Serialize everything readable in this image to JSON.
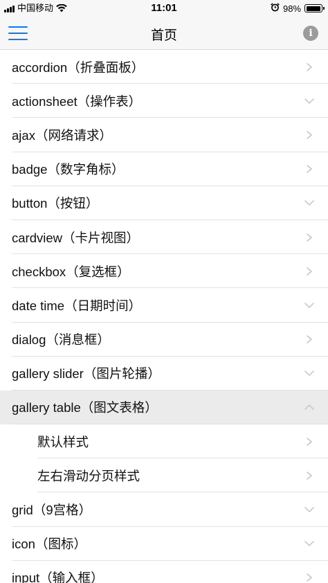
{
  "status_bar": {
    "carrier": "中国移动",
    "time": "11:01",
    "battery": "98%",
    "battery_level": 0.98
  },
  "nav": {
    "title": "首页",
    "menu_icon": "hamburger-menu-icon",
    "info_icon": "info-icon",
    "info_glyph": "i",
    "accent_color": "#007aff"
  },
  "list": {
    "items": [
      {
        "label": "accordion（折叠面板）",
        "icon": "chevron-right-icon"
      },
      {
        "label": "actionsheet（操作表）",
        "icon": "chevron-down-icon"
      },
      {
        "label": "ajax（网络请求）",
        "icon": "chevron-right-icon"
      },
      {
        "label": "badge（数字角标）",
        "icon": "chevron-right-icon"
      },
      {
        "label": "button（按钮）",
        "icon": "chevron-down-icon"
      },
      {
        "label": "cardview（卡片视图）",
        "icon": "chevron-right-icon"
      },
      {
        "label": "checkbox（复选框）",
        "icon": "chevron-right-icon"
      },
      {
        "label": "date time（日期时间）",
        "icon": "chevron-down-icon"
      },
      {
        "label": "dialog（消息框）",
        "icon": "chevron-right-icon"
      },
      {
        "label": "gallery slider（图片轮播）",
        "icon": "chevron-down-icon"
      },
      {
        "label": "gallery table（图文表格）",
        "icon": "chevron-up-icon",
        "expanded": true,
        "children": [
          {
            "label": "默认样式",
            "icon": "chevron-right-icon"
          },
          {
            "label": "左右滑动分页样式",
            "icon": "chevron-right-icon"
          }
        ]
      },
      {
        "label": "grid（9宫格）",
        "icon": "chevron-down-icon"
      },
      {
        "label": "icon（图标）",
        "icon": "chevron-down-icon"
      },
      {
        "label": "input（输入框）",
        "icon": "chevron-right-icon"
      }
    ]
  }
}
